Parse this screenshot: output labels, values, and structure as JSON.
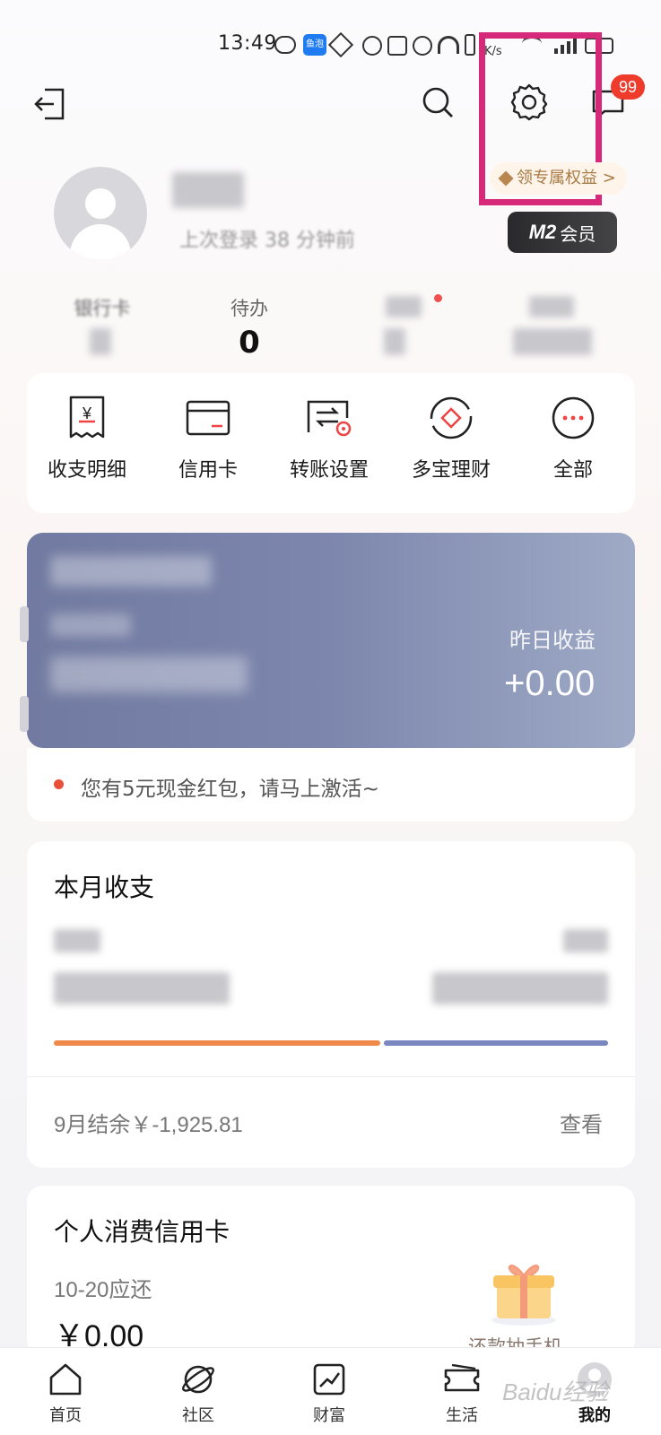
{
  "status_bar": {
    "time": "13:49",
    "app_badge": "鱼泡",
    "battery": "4",
    "net": "K/s"
  },
  "header": {
    "message_badge": "99"
  },
  "profile": {
    "rights_label": "领专属权益 >",
    "member_level": "M2",
    "member_text": "会员",
    "last_login": "上次登录 38 分钟前"
  },
  "stats": [
    {
      "label": "银行卡",
      "value": ""
    },
    {
      "label": "待办",
      "value": "0"
    },
    {
      "label": "",
      "value": ""
    },
    {
      "label": "",
      "value": ""
    }
  ],
  "shortcuts": [
    {
      "label": "收支明细",
      "icon": "receipt-icon"
    },
    {
      "label": "信用卡",
      "icon": "credit-card-icon"
    },
    {
      "label": "转账设置",
      "icon": "transfer-settings-icon"
    },
    {
      "label": "多宝理财",
      "icon": "wealth-icon"
    },
    {
      "label": "全部",
      "icon": "more-icon"
    }
  ],
  "account": {
    "yesterday_label": "昨日收益",
    "yesterday_value": "+0.00",
    "notice": "您有5元现金红包，请马上激活~"
  },
  "monthly": {
    "title": "本月收支",
    "balance_text": "9月结余￥-1,925.81",
    "view_label": "查看",
    "expense_share": 0.54
  },
  "credit": {
    "title": "个人消费信用卡",
    "due_label": "10-20应还",
    "due_value": "￥0.00",
    "promo": "还款抽手机"
  },
  "bottom_nav": [
    {
      "label": "首页",
      "icon": "home-icon"
    },
    {
      "label": "社区",
      "icon": "planet-icon"
    },
    {
      "label": "财富",
      "icon": "chart-icon"
    },
    {
      "label": "生活",
      "icon": "ticket-icon"
    },
    {
      "label": "我的",
      "icon": "profile-icon"
    }
  ],
  "watermark": "Baidu经验",
  "colors": {
    "highlight": "#d6297a",
    "badge": "#ee3b2c",
    "accent_orange": "#f08a4b",
    "accent_blue": "#7a86c0"
  }
}
